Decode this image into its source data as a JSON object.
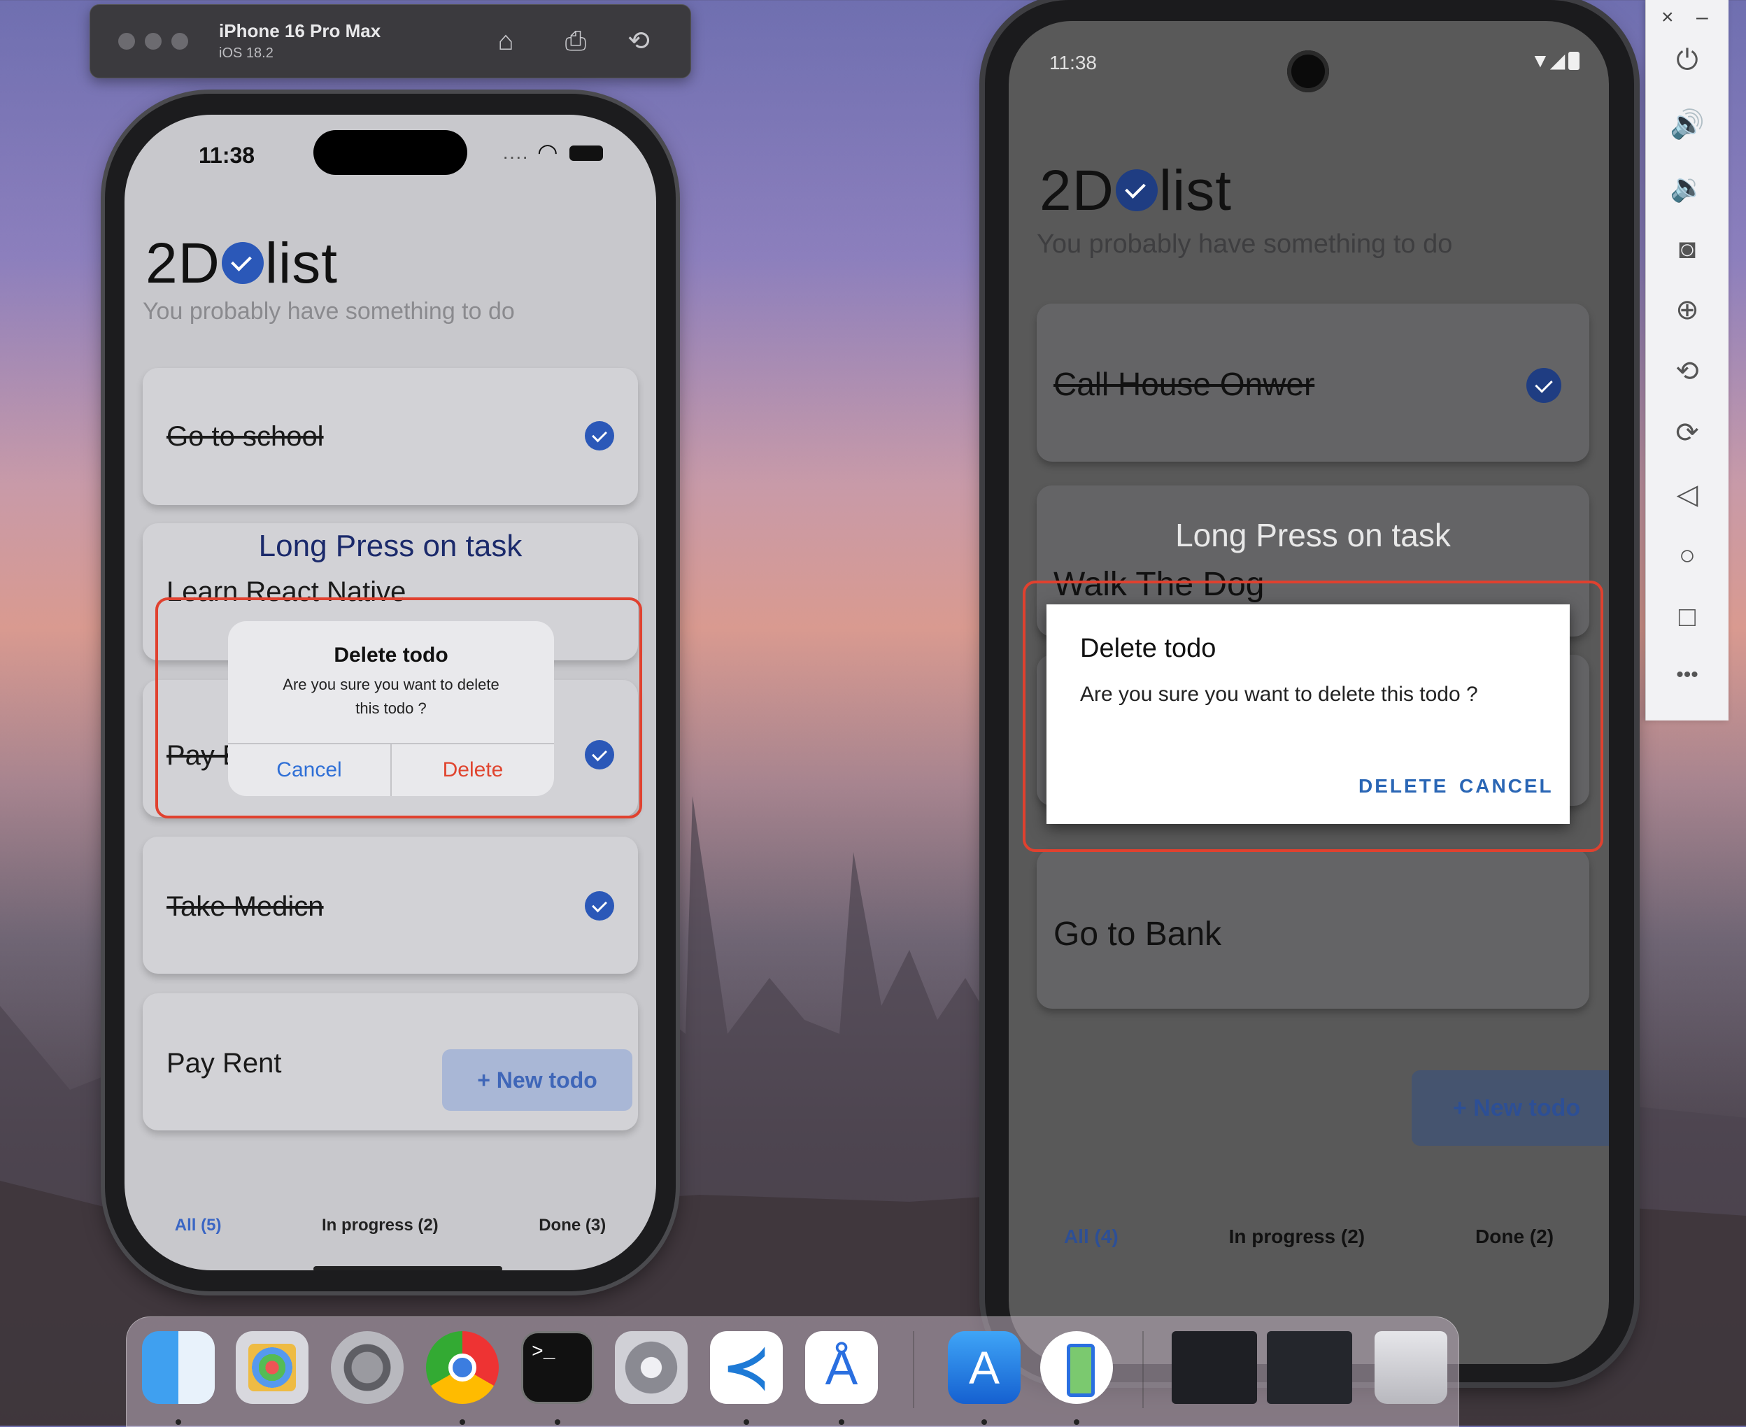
{
  "simulator": {
    "device": "iPhone 16 Pro Max",
    "os": "iOS 18.2"
  },
  "ios": {
    "time": "11:38",
    "logo_left": "2D",
    "logo_right": "list",
    "subtitle": "You probably have something to do",
    "tasks": [
      {
        "title": "Go to school",
        "done": true
      },
      {
        "title": "Learn React Native",
        "done": false
      },
      {
        "title": "Pay B",
        "done": true
      },
      {
        "title": "Take Medicn",
        "done": true
      },
      {
        "title": "Pay Rent",
        "done": false
      }
    ],
    "hint": "Long Press on task",
    "new_todo": "+ New todo",
    "tabs": [
      "All (5)",
      "In progress (2)",
      "Done (3)"
    ],
    "alert": {
      "title": "Delete todo",
      "message_line1": "Are you sure you want to delete",
      "message_line2": "this todo ?",
      "cancel": "Cancel",
      "delete": "Delete"
    }
  },
  "android": {
    "time": "11:38",
    "logo_left": "2D",
    "logo_right": "list",
    "subtitle": "You probably have something to do",
    "tasks": [
      {
        "title": "Call House Onwer",
        "done": true
      },
      {
        "title": "Walk The Dog",
        "done": false
      },
      {
        "title": "Go to Bank",
        "done": false
      }
    ],
    "hint": "Long Press on task",
    "new_todo": "+ New todo",
    "tabs": [
      "All (4)",
      "In progress (2)",
      "Done (2)"
    ],
    "dialog": {
      "title": "Delete todo",
      "message": "Are you sure you want to delete this todo ?",
      "delete": "DELETE",
      "cancel": "CANCEL"
    }
  },
  "emulator_panel": {
    "close": "×",
    "minimize": "–",
    "more": "•••"
  },
  "colors": {
    "accent": "#2b58b8",
    "ios_link": "#2f6fd6",
    "ios_delete": "#e0452f",
    "highlight": "#e0412f",
    "android_button": "#2a66b5"
  }
}
